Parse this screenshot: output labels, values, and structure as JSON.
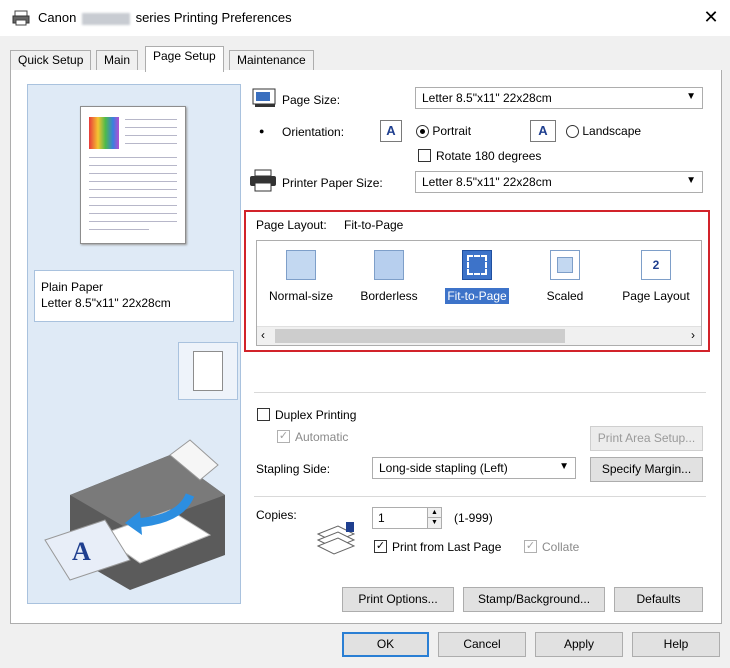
{
  "window": {
    "title_prefix": "Canon",
    "title_suffix": "series Printing Preferences",
    "close_glyph": "✕"
  },
  "tabs": [
    {
      "label": "Quick Setup",
      "active": false
    },
    {
      "label": "Main",
      "active": false
    },
    {
      "label": "Page Setup",
      "active": true
    },
    {
      "label": "Maintenance",
      "active": false
    }
  ],
  "preview": {
    "media_type": "Plain Paper",
    "paper_size": "Letter 8.5\"x11\" 22x28cm"
  },
  "page_size": {
    "label": "Page Size:",
    "value": "Letter 8.5\"x11\" 22x28cm"
  },
  "orientation": {
    "label": "Orientation:",
    "portrait_label": "Portrait",
    "landscape_label": "Landscape",
    "selected": "Portrait",
    "icon_glyph": "A"
  },
  "rotate": {
    "label": "Rotate 180 degrees",
    "checked": false
  },
  "printer_paper_size": {
    "label": "Printer Paper Size:",
    "value": "Letter 8.5\"x11\" 22x28cm"
  },
  "page_layout": {
    "label": "Page Layout:",
    "current": "Fit-to-Page",
    "items": [
      {
        "label": "Normal-size",
        "icon": "normal-size-icon"
      },
      {
        "label": "Borderless",
        "icon": "borderless-icon"
      },
      {
        "label": "Fit-to-Page",
        "icon": "fit-to-page-icon"
      },
      {
        "label": "Scaled",
        "icon": "scaled-icon"
      },
      {
        "label": "Page Layout",
        "icon": "page-layout-icon",
        "glyph": "2"
      }
    ],
    "selected": "Fit-to-Page",
    "scroll_left": "‹",
    "scroll_right": "›"
  },
  "duplex": {
    "label": "Duplex Printing",
    "checked": false,
    "automatic_label": "Automatic",
    "automatic_checked": true,
    "check_glyph": "✓"
  },
  "print_area_setup": {
    "label": "Print Area Setup..."
  },
  "stapling": {
    "label": "Stapling Side:",
    "value": "Long-side stapling (Left)"
  },
  "specify_margin": {
    "label": "Specify Margin..."
  },
  "copies": {
    "label": "Copies:",
    "value": "1",
    "range": "(1-999)",
    "print_from_last_label": "Print from Last Page",
    "print_from_last_checked": true,
    "collate_label": "Collate",
    "collate_checked": true
  },
  "buttons": {
    "print_options": "Print Options...",
    "stamp_background": "Stamp/Background...",
    "defaults": "Defaults",
    "ok": "OK",
    "cancel": "Cancel",
    "apply": "Apply",
    "help": "Help"
  },
  "colors": {
    "highlight_frame": "#d2232a",
    "selection": "#3d73c9",
    "preview_bg": "#dfeaf6"
  }
}
